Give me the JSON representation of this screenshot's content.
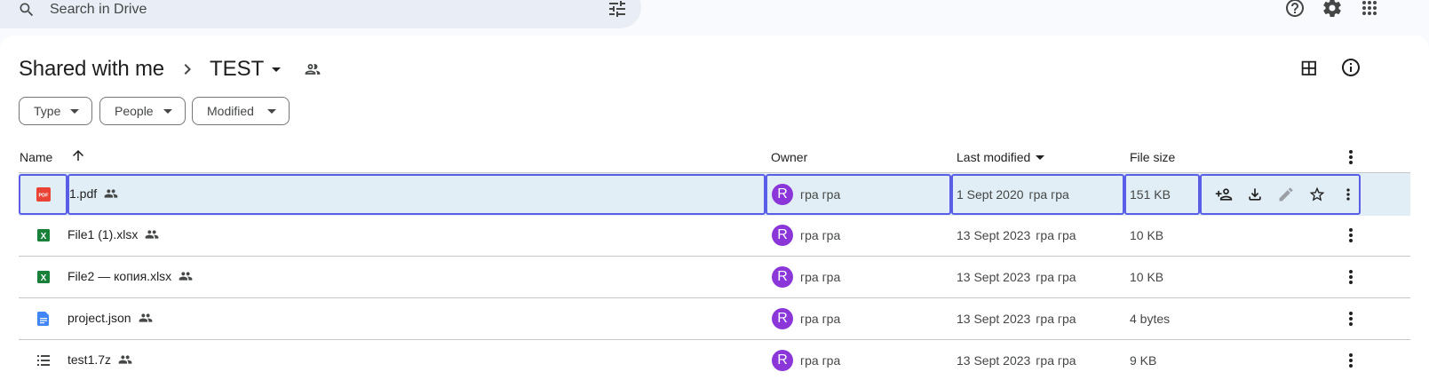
{
  "search": {
    "placeholder": "Search in Drive"
  },
  "breadcrumb": {
    "root": "Shared with me",
    "current": "TEST"
  },
  "filters": [
    {
      "label": "Type"
    },
    {
      "label": "People"
    },
    {
      "label": "Modified"
    }
  ],
  "columns": {
    "name": "Name",
    "owner": "Owner",
    "last_modified": "Last modified",
    "file_size": "File size"
  },
  "files": [
    {
      "name": "1.pdf",
      "type": "pdf",
      "owner_initial": "R",
      "owner": "грa грa",
      "modified": "1 Sept 2020",
      "modified_by": "грa грa",
      "size": "151 KB",
      "selected": true
    },
    {
      "name": "File1 (1).xlsx",
      "type": "xlsx",
      "owner_initial": "R",
      "owner": "грa грa",
      "modified": "13 Sept 2023",
      "modified_by": "грa грa",
      "size": "10 KB",
      "selected": false
    },
    {
      "name": "File2 — копия.xlsx",
      "type": "xlsx",
      "owner_initial": "R",
      "owner": "грa грa",
      "modified": "13 Sept 2023",
      "modified_by": "грa грa",
      "size": "10 KB",
      "selected": false
    },
    {
      "name": "project.json",
      "type": "doc",
      "owner_initial": "R",
      "owner": "грa грa",
      "modified": "13 Sept 2023",
      "modified_by": "грa грa",
      "size": "4 bytes",
      "selected": false
    },
    {
      "name": "test1.7z",
      "type": "archive",
      "owner_initial": "R",
      "owner": "грa грa",
      "modified": "13 Sept 2023",
      "modified_by": "грa грa",
      "size": "9 KB",
      "selected": false
    }
  ],
  "icons": {
    "search": "search-icon",
    "tune": "tune-icon",
    "help": "help-icon",
    "settings": "gear-icon",
    "apps": "apps-grid-icon",
    "grid_view": "grid-view-icon",
    "details": "info-icon",
    "row_actions": [
      "share-icon",
      "download-icon",
      "rename-icon",
      "star-icon",
      "more-vert-icon"
    ]
  },
  "colors": {
    "accent_selection": "#5a5ee6",
    "selected_row": "#e1eef5",
    "avatar": "#8b36d9",
    "pdf_red": "#ea4335",
    "sheets_green": "#188038",
    "docs_blue": "#4285f4"
  }
}
